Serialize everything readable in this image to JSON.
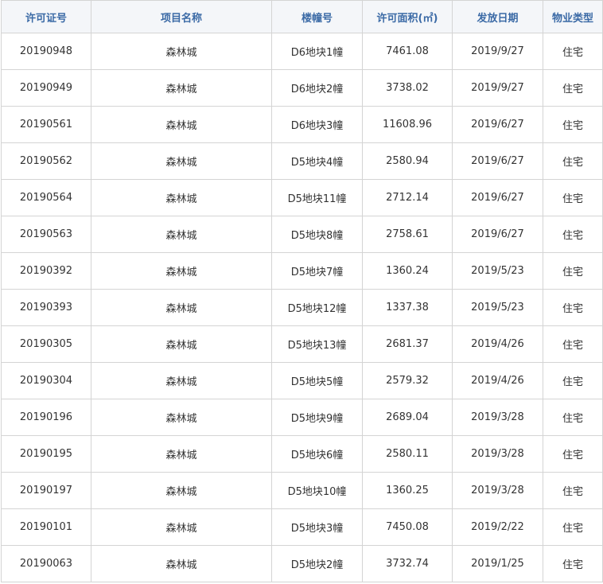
{
  "table": {
    "columns": [
      "许可证号",
      "项目名称",
      "楼幢号",
      "许可面积(㎡)",
      "发放日期",
      "物业类型"
    ],
    "rows": [
      [
        "20190948",
        "森林城",
        "D6地块1幢",
        "7461.08",
        "2019/9/27",
        "住宅"
      ],
      [
        "20190949",
        "森林城",
        "D6地块2幢",
        "3738.02",
        "2019/9/27",
        "住宅"
      ],
      [
        "20190561",
        "森林城",
        "D6地块3幢",
        "11608.96",
        "2019/6/27",
        "住宅"
      ],
      [
        "20190562",
        "森林城",
        "D5地块4幢",
        "2580.94",
        "2019/6/27",
        "住宅"
      ],
      [
        "20190564",
        "森林城",
        "D5地块11幢",
        "2712.14",
        "2019/6/27",
        "住宅"
      ],
      [
        "20190563",
        "森林城",
        "D5地块8幢",
        "2758.61",
        "2019/6/27",
        "住宅"
      ],
      [
        "20190392",
        "森林城",
        "D5地块7幢",
        "1360.24",
        "2019/5/23",
        "住宅"
      ],
      [
        "20190393",
        "森林城",
        "D5地块12幢",
        "1337.38",
        "2019/5/23",
        "住宅"
      ],
      [
        "20190305",
        "森林城",
        "D5地块13幢",
        "2681.37",
        "2019/4/26",
        "住宅"
      ],
      [
        "20190304",
        "森林城",
        "D5地块5幢",
        "2579.32",
        "2019/4/26",
        "住宅"
      ],
      [
        "20190196",
        "森林城",
        "D5地块9幢",
        "2689.04",
        "2019/3/28",
        "住宅"
      ],
      [
        "20190195",
        "森林城",
        "D5地块6幢",
        "2580.11",
        "2019/3/28",
        "住宅"
      ],
      [
        "20190197",
        "森林城",
        "D5地块10幢",
        "1360.25",
        "2019/3/28",
        "住宅"
      ],
      [
        "20190101",
        "森林城",
        "D5地块3幢",
        "7450.08",
        "2019/2/22",
        "住宅"
      ],
      [
        "20190063",
        "森林城",
        "D5地块2幢",
        "3732.74",
        "2019/1/25",
        "住宅"
      ]
    ]
  },
  "colors": {
    "header_text": "#3b6aa6",
    "header_bg": "#f4f6f9",
    "border": "#d4d4d4",
    "cell_text": "#333333"
  }
}
